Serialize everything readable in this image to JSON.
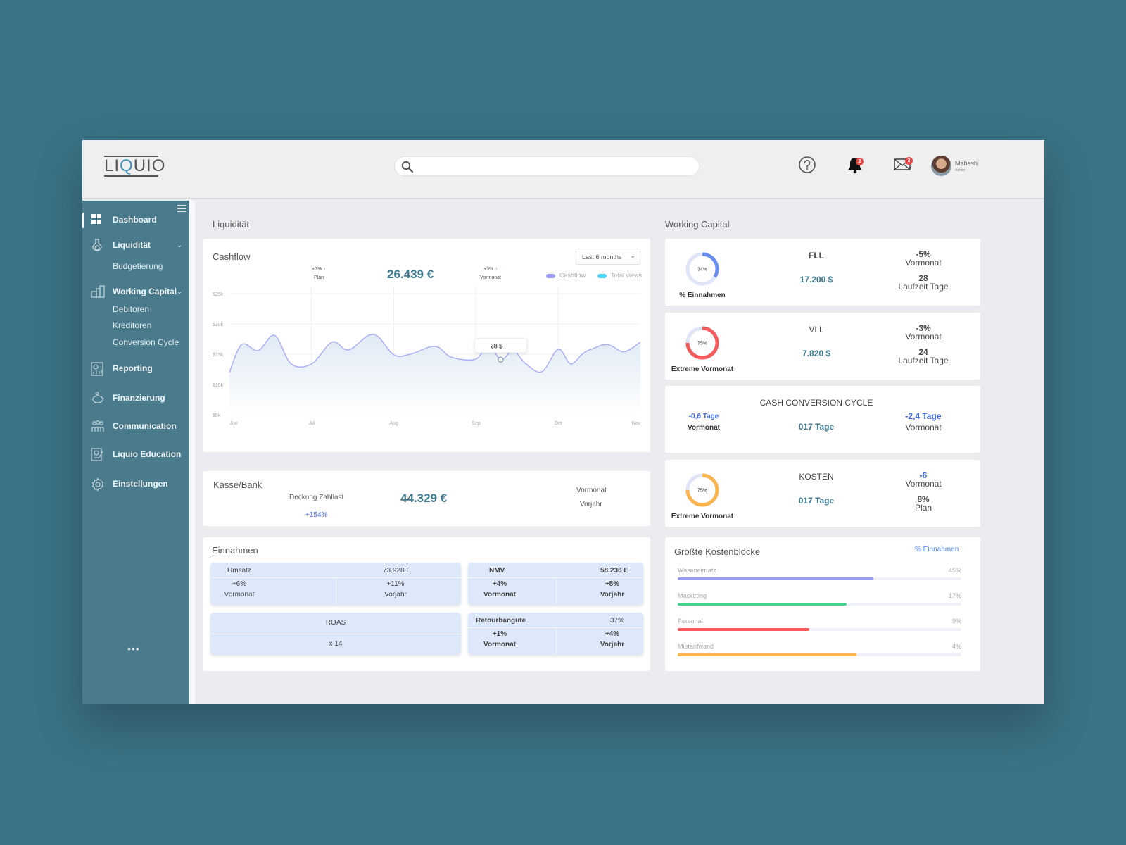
{
  "app": {
    "logo": {
      "prefix": "LI",
      "q": "Q",
      "suffix": "UIO"
    },
    "search": {
      "placeholder": "",
      "value": ""
    },
    "header": {
      "help_icon": "question-circle-icon",
      "notifications": {
        "icon": "bell-icon",
        "count": "2"
      },
      "messages": {
        "icon": "envelope-icon",
        "count": "3"
      },
      "user": {
        "name": "Mahesh",
        "role": "Admin"
      }
    }
  },
  "sidebar": {
    "items": [
      {
        "label": "Dashboard",
        "icon": "grid-icon",
        "active": true
      },
      {
        "label": "Liquidität",
        "icon": "flask-coin-icon",
        "expandable": true,
        "children": [
          "Budgetierung"
        ]
      },
      {
        "label": "Working Capital",
        "icon": "buildings-icon",
        "expandable": true,
        "children": [
          "Debitoren",
          "Kreditoren",
          "Conversion Cycle"
        ]
      },
      {
        "label": "Reporting",
        "icon": "report-icon"
      },
      {
        "label": "Finanzierung",
        "icon": "piggy-bank-icon"
      },
      {
        "label": "Communication",
        "icon": "people-icon"
      },
      {
        "label": "Liquio Education",
        "icon": "certificate-icon"
      },
      {
        "label": "Einstellungen",
        "icon": "gear-icon"
      }
    ],
    "more": "•••"
  },
  "liquiditaet": {
    "section_title": "Liquidität",
    "cashflow": {
      "title": "Cashflow",
      "value": "26.439 €",
      "kpis": [
        {
          "delta": "+3%",
          "label": "Plan"
        },
        {
          "delta": "+3%",
          "label": "Vormonat"
        }
      ],
      "range_select": {
        "selected": "Last 6 months"
      },
      "tooltip": "28 $"
    },
    "kasse_bank": {
      "title": "Kasse/Bank",
      "label": "Deckung Zahllast",
      "delta": "+154%",
      "value": "44.329 €",
      "right_labels": [
        "Vormonat",
        "Vorjahr"
      ]
    },
    "einnahmen": {
      "title": "Einnahmen",
      "umsatz": {
        "label": "Umsatz",
        "value": "73.928 E",
        "left": {
          "delta": "+6%",
          "label": "Vormonat"
        },
        "right": {
          "delta": "+11%",
          "label": "Vorjahr"
        }
      },
      "nmv": {
        "label": "NMV",
        "value": "58.236 E",
        "left": {
          "delta": "+4%",
          "label": "Vormonat"
        },
        "right": {
          "delta": "+8%",
          "label": "Vorjahr"
        }
      },
      "roas": {
        "label": "ROAS",
        "value": "x 14"
      },
      "retour": {
        "label": "Retourbangute",
        "value": "37%",
        "left": {
          "delta": "+1%",
          "label": "Vormonat"
        },
        "right": {
          "delta": "+4%",
          "label": "Vorjahr"
        }
      }
    }
  },
  "working_capital": {
    "section_title": "Working Capital",
    "cards": [
      {
        "title": "FLL",
        "value": "17.200 $",
        "donut_pct": 34,
        "donut_label": "34%",
        "donut_caption": "% Einnahmen",
        "donut_color": "#6b8ff0",
        "r1_top": "-5%",
        "r1_bottom": "Vormonat",
        "r2_top": "28",
        "r2_bottom": "Laufzeit Tage"
      },
      {
        "title": "VLL",
        "value": "7.820 $",
        "donut_pct": 75,
        "donut_label": "75%",
        "donut_caption": "Extreme Vormonat",
        "donut_color": "#f25c5c",
        "r1_top": "-3%",
        "r1_bottom": "Vormonat",
        "r2_top": "24",
        "r2_bottom": "Laufzeit Tage"
      },
      {
        "title": "CASH CONVERSION CYCLE",
        "value": "017 Tage",
        "left_top": "-0,6 Tage",
        "left_bottom": "Vormonat",
        "right_top": "-2,4 Tage",
        "right_bottom": "Vormonat"
      },
      {
        "title": "KOSTEN",
        "value": "017 Tage",
        "donut_pct": 75,
        "donut_label": "75%",
        "donut_caption": "Extreme Vormonat",
        "donut_color": "#fbb550",
        "r1_top": "-6",
        "r1_bottom": "Vormonat",
        "r2_top": "8%",
        "r2_bottom": "Plan"
      }
    ],
    "kostenbloecke": {
      "title": "Größte Kostenblöcke",
      "link": "%  Einnahmen",
      "rows": [
        {
          "name": "Waseneirnatz",
          "pct_label": "45%",
          "fill": 0.69,
          "color": "#9a9cf2"
        },
        {
          "name": "Macketing",
          "pct_label": "17%",
          "fill": 0.595,
          "color": "#47d48a"
        },
        {
          "name": "Personal",
          "pct_label": "9%",
          "fill": 0.465,
          "color": "#f25c5c"
        },
        {
          "name": "Mietanfwand",
          "pct_label": "4%",
          "fill": 0.63,
          "color": "#fbb550"
        }
      ]
    }
  },
  "chart_data": {
    "type": "area",
    "title": "Cashflow",
    "xlabel": "",
    "ylabel": "",
    "x_ticks": [
      "Jun",
      "Jul",
      "Aug",
      "Sep",
      "Oct",
      "Nov"
    ],
    "y_ticks": [
      "$5k",
      "$10k",
      "$15k",
      "$20k",
      "$25k"
    ],
    "ylim": [
      5000,
      25000
    ],
    "grid": true,
    "legend": [
      {
        "name": "Cashflow",
        "color": "#9a9cf2"
      },
      {
        "name": "Total views",
        "color": "#4dd0f5"
      }
    ],
    "legend_position": "top-right",
    "series": [
      {
        "name": "Cashflow",
        "x": [
          0,
          0.15,
          0.35,
          0.55,
          0.75,
          1.0,
          1.25,
          1.45,
          1.75,
          2.0,
          2.2,
          2.5,
          2.7,
          3.0,
          3.15,
          3.3,
          3.45,
          3.6,
          3.8,
          4.0,
          4.15,
          4.3,
          4.4,
          4.6,
          4.8,
          5.0
        ],
        "y": [
          12000,
          16600,
          15600,
          18100,
          13400,
          13400,
          17000,
          15700,
          18300,
          14900,
          15000,
          16300,
          14500,
          14200,
          16800,
          14100,
          15600,
          13500,
          12100,
          15800,
          13400,
          15100,
          15800,
          16600,
          15400,
          17000
        ]
      }
    ],
    "tooltip": {
      "x": 3.3,
      "label": "28 $"
    }
  }
}
